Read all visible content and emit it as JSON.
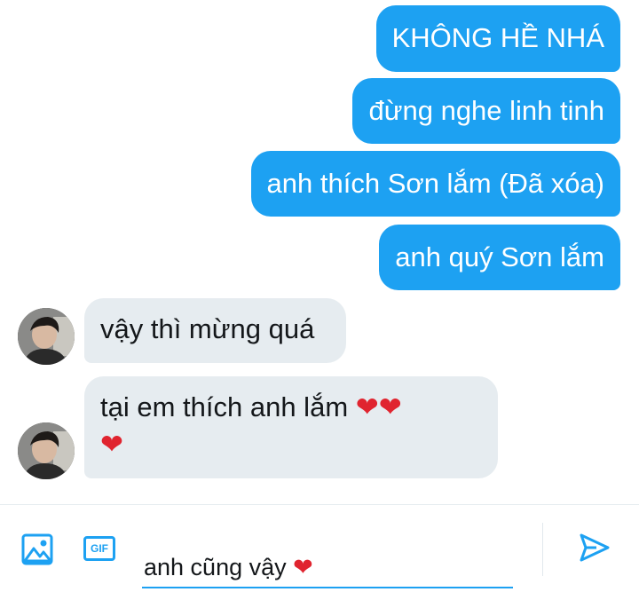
{
  "messages": {
    "sent": [
      "KHÔNG HỀ NHÁ",
      "đừng nghe linh tinh",
      "anh thích Sơn lắm (Đã xóa)",
      "anh quý Sơn lắm"
    ],
    "received": [
      {
        "text": "vậy thì mừng quá"
      },
      {
        "text": "tại em thích anh lắm",
        "hearts_line1": "❤❤",
        "hearts_line2": "❤"
      }
    ]
  },
  "composer": {
    "gif_label": "GIF",
    "input_value": "anh cũng vậy",
    "input_emoji": "❤"
  },
  "colors": {
    "accent": "#1da1f2",
    "received_bubble": "#e6ecf0",
    "heart": "#e0242f"
  },
  "icons": [
    "image-icon",
    "gif-icon",
    "send-icon",
    "avatar"
  ]
}
